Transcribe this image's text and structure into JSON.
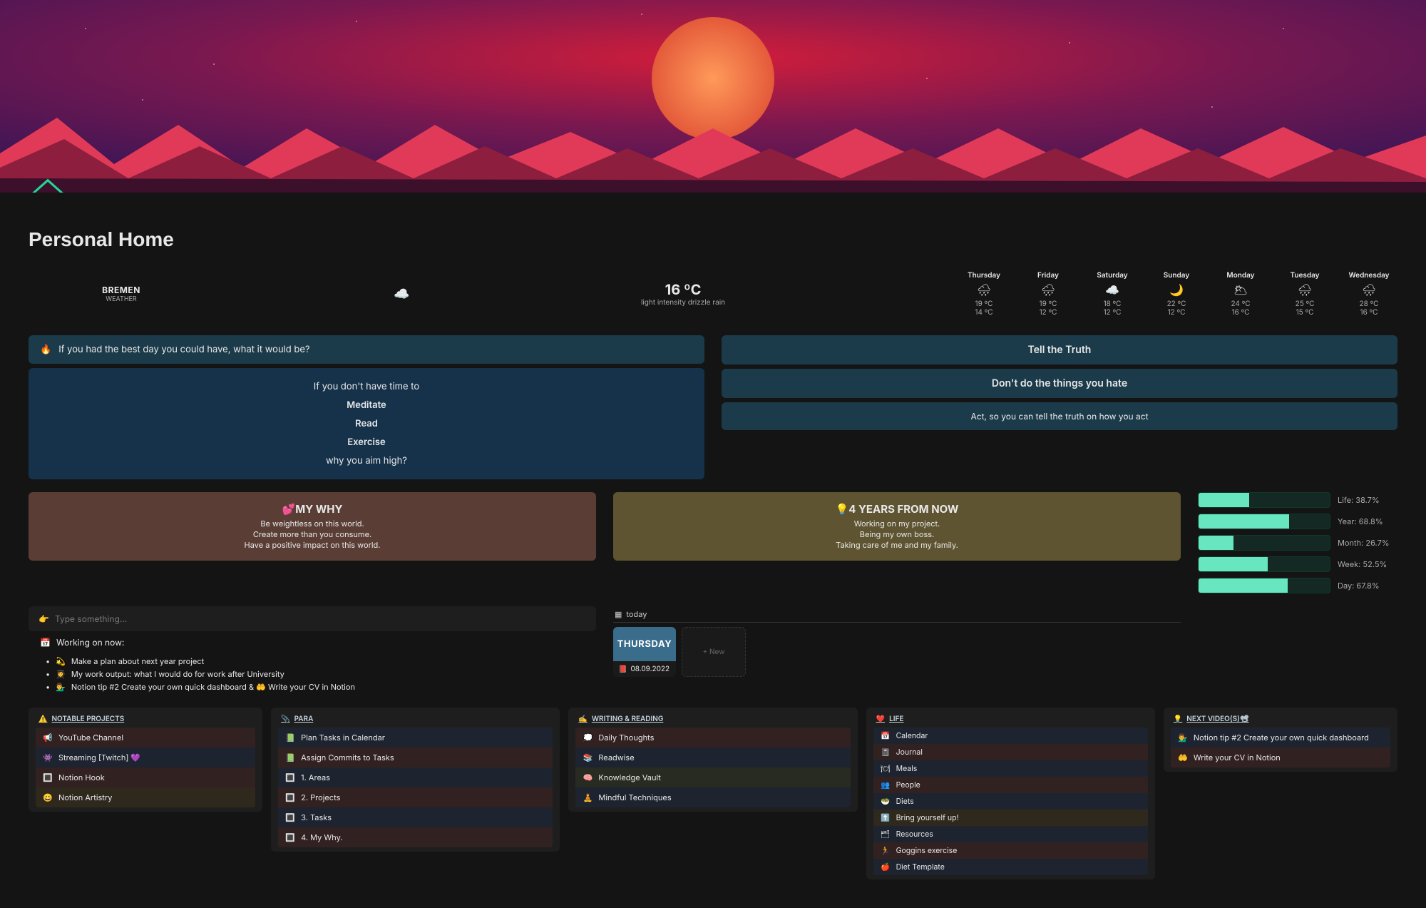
{
  "page_title": "Personal Home",
  "weather": {
    "city": "BREMEN",
    "city_label": "WEATHER",
    "now_icon": "☁️",
    "now_temp": "16 ºC",
    "now_desc": "light intensity drizzle rain",
    "forecast": [
      {
        "day": "Thursday",
        "icon": "🌧",
        "hi": "19 ºC",
        "lo": "14 ºC"
      },
      {
        "day": "Friday",
        "icon": "🌧",
        "hi": "19 ºC",
        "lo": "12 ºC"
      },
      {
        "day": "Saturday",
        "icon": "☁️",
        "hi": "18 ºC",
        "lo": "12 ºC"
      },
      {
        "day": "Sunday",
        "icon": "🌙",
        "hi": "22 ºC",
        "lo": "12 ºC"
      },
      {
        "day": "Monday",
        "icon": "🌥",
        "hi": "24 ºC",
        "lo": "16 ºC"
      },
      {
        "day": "Tuesday",
        "icon": "🌧",
        "hi": "25 ºC",
        "lo": "15 ºC"
      },
      {
        "day": "Wednesday",
        "icon": "🌧",
        "hi": "28 ºC",
        "lo": "16 ºC"
      }
    ]
  },
  "journal_prompt": {
    "emoji": "🔥",
    "text": "If you had the best day you could have, what it would be?"
  },
  "time_block": {
    "line1": "If you don't have time to",
    "line2": "Meditate",
    "line3": "Read",
    "line4": "Exercise",
    "line5": "why you aim high?"
  },
  "principles": [
    "Tell the Truth",
    "Don't do the things you hate",
    "Act, so you can tell the truth on how you act"
  ],
  "my_why": {
    "title": "💕MY WHY",
    "lines": [
      "Be weightless on this world.",
      "Create more than you consume.",
      "Have a positive impact on this world."
    ]
  },
  "four_years": {
    "title": "💡4 YEARS FROM NOW",
    "lines": [
      "Working on my project.",
      "Being my own boss.",
      "Taking care of me and my family."
    ]
  },
  "progress": [
    {
      "label": "Life: 38.7%",
      "pct": 38.7
    },
    {
      "label": "Year: 68.8%",
      "pct": 68.8
    },
    {
      "label": "Month: 26.7%",
      "pct": 26.7
    },
    {
      "label": "Week: 52.5%",
      "pct": 52.5
    },
    {
      "label": "Day: 67.8%",
      "pct": 67.8
    }
  ],
  "quick_input": {
    "emoji": "👉",
    "placeholder": "Type something..."
  },
  "working_on": {
    "icon": "📅",
    "label": "Working on now:"
  },
  "bullets": [
    {
      "emoji": "💫",
      "text": "Make a plan about next year project"
    },
    {
      "emoji": "👩‍🎓",
      "text": "My work output: what I would do for work after University"
    },
    {
      "emoji": "💁‍♂️",
      "text": "Notion tip #2 Create your own quick dashboard & 🤲 Write your CV in Notion"
    }
  ],
  "today": {
    "view_label": "today",
    "card_img_text": "THURSDAY",
    "card_emoji": "📕",
    "card_date": "08.09.2022",
    "new_label": "+  New"
  },
  "col_titles": {
    "projects": "NOTABLE PROJECTS",
    "para": "PARA",
    "writing": "WRITING & READING",
    "life": "LIFE",
    "videos": "NEXT VIDEO(S)📽"
  },
  "col_emoji": {
    "projects": "⚠️",
    "para": "📎",
    "writing": "✍️",
    "life": "❤️",
    "videos": "💡"
  },
  "projects": [
    {
      "emoji": "📢",
      "text": "YouTube Channel"
    },
    {
      "emoji": "👾",
      "text": "Streaming [Twitch] 💜"
    },
    {
      "emoji": "🔳",
      "text": "Notion Hook"
    },
    {
      "emoji": "😀",
      "text": "Notion Artistry"
    }
  ],
  "para": [
    {
      "emoji": "📗",
      "text": "Plan Tasks in Calendar"
    },
    {
      "emoji": "📗",
      "text": "Assign Commits to Tasks"
    },
    {
      "emoji": "🔳",
      "text": "1. Areas"
    },
    {
      "emoji": "🔳",
      "text": "2. Projects"
    },
    {
      "emoji": "🔳",
      "text": "3. Tasks"
    },
    {
      "emoji": "🔳",
      "text": "4. My Why."
    }
  ],
  "writing": [
    {
      "emoji": "💭",
      "text": "Daily Thoughts"
    },
    {
      "emoji": "📚",
      "text": "Readwise"
    },
    {
      "emoji": "🧠",
      "text": "Knowledge Vault"
    },
    {
      "emoji": "🧘",
      "text": "Mindful Techniques"
    }
  ],
  "life": [
    {
      "emoji": "📅",
      "text": "Calendar"
    },
    {
      "emoji": "📓",
      "text": "Journal"
    },
    {
      "emoji": "🍽",
      "text": "Meals"
    },
    {
      "emoji": "👥",
      "text": "People"
    },
    {
      "emoji": "🥗",
      "text": "Diets"
    },
    {
      "emoji": "⬆️",
      "text": "Bring yourself up!"
    },
    {
      "emoji": "🗂",
      "text": "Resources"
    },
    {
      "emoji": "🏃",
      "text": "Goggins exercise"
    },
    {
      "emoji": "🍎",
      "text": "Diet Template"
    }
  ],
  "videos": [
    {
      "emoji": "💁‍♂️",
      "text": "Notion tip #2 Create your own quick dashboard"
    },
    {
      "emoji": "🤲",
      "text": "Write your CV in Notion"
    }
  ]
}
